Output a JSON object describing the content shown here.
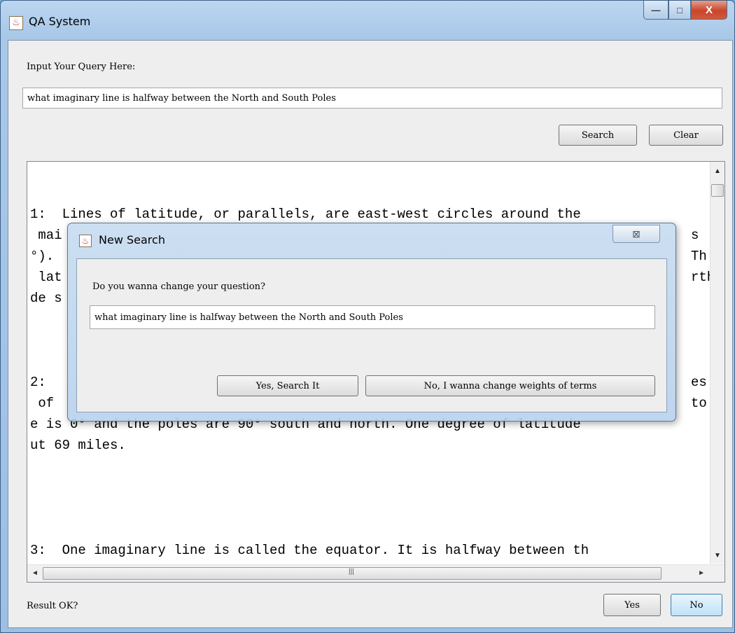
{
  "window": {
    "title": "QA System",
    "minimize_glyph": "—",
    "maximize_glyph": "□",
    "close_glyph": "X"
  },
  "query": {
    "label": "Input Your Query Here:",
    "value": "what imaginary line is halfway between the North and South Poles"
  },
  "actions": {
    "search_label": "Search",
    "clear_label": "Clear"
  },
  "results": {
    "lines": [
      "",
      "",
      "1:  Lines of latitude, or parallels, are east-west circles around the",
      " mai",
      "°).",
      " lat",
      "de s",
      "",
      "",
      "",
      "2:",
      " of",
      "e is 0° and the poles are 90° south and north. One degree of latitude",
      "ut 69 miles.",
      "",
      "",
      "",
      "",
      "3:  One imaginary line is called the equator. It is halfway between th"
    ],
    "right_fragments": [
      "s ",
      "Th",
      "rth",
      "es",
      "to"
    ]
  },
  "feedback": {
    "label": "Result OK?",
    "yes_label": "Yes",
    "no_label": "No"
  },
  "dialog": {
    "title": "New Search",
    "close_glyph": "⊠",
    "question": "Do you wanna change your question?",
    "input_value": "what imaginary line is halfway between the North and South Poles",
    "yes_label": "Yes, Search It",
    "no_label": "No, I wanna change weights of terms"
  },
  "icons": {
    "app": "java-cup-icon",
    "scroll_up": "▲",
    "scroll_down": "▼",
    "scroll_left": "◄",
    "scroll_right": "►",
    "grip": "|||"
  }
}
